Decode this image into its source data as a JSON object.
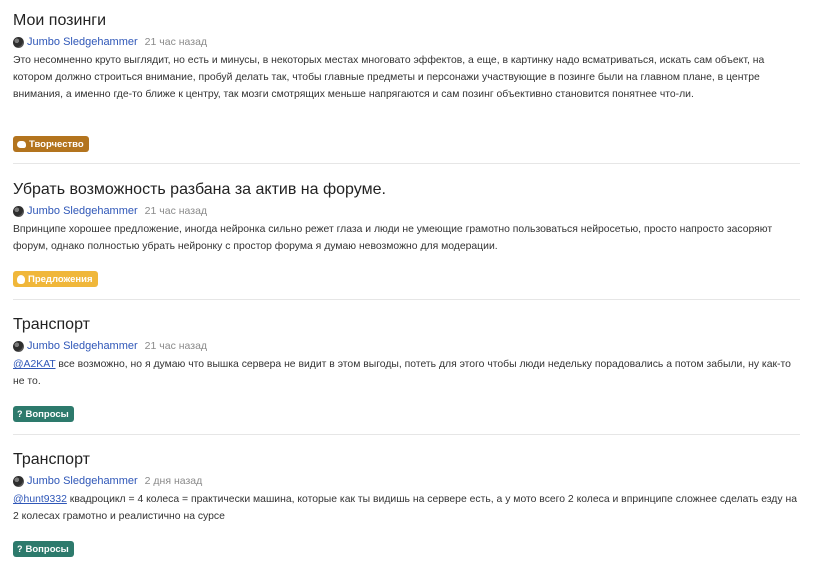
{
  "posts": [
    {
      "title": "Мои позинги",
      "author": "Jumbo Sledgehammer",
      "time": "21 час назад",
      "mention": "",
      "body": "Это несомненно круто выглядит, но есть и минусы, в некоторых местах многовато эффектов, а еще, в картинку надо всматриваться, искать сам объект, на котором должно строиться внимание, пробуй делать так, чтобы главные предметы и персонажи участвующие в позинге были на главном плане, в центре внимания, а именно где-то ближе к центру, так мозги смотрящих меньше напрягаются и сам позинг объективно становится понятнее что-ли.",
      "tag": "Творчество",
      "tag_icon": "palette-icon",
      "tag_color": "#b3741e"
    },
    {
      "title": "Убрать возможность разбана за актив на форуме.",
      "author": "Jumbo Sledgehammer",
      "time": "21 час назад",
      "mention": "",
      "body": "Впринципе хорошее предложение, иногда нейронка сильно режет глаза и люди не умеющие грамотно пользоваться нейросетью, просто напросто засоряют форум, однако полностью убрать нейронку с простор форума я думаю невозможно для модерации.",
      "tag": "Предложения",
      "tag_icon": "lightbulb-icon",
      "tag_color": "#f0b73a"
    },
    {
      "title": "Транспорт",
      "author": "Jumbo Sledgehammer",
      "time": "21 час назад",
      "mention": "@A2KAT",
      "body": " все возможно, но я думаю что вышка сервера не видит в этом выгоды, потеть для этого чтобы люди недельку порадовались а потом забыли, ну как-то не то.",
      "tag": "Вопросы",
      "tag_icon": "question-icon",
      "tag_color": "#2d7a6c"
    },
    {
      "title": "Транспорт",
      "author": "Jumbo Sledgehammer",
      "time": "2 дня назад",
      "mention": "@hunt9332",
      "body": " квадроцикл = 4 колеса = практически машина, которые как ты видишь на сервере есть, а у мото всего 2 колеса и впринципе сложнее сделать езду на 2 колесах грамотно и реалистично на сурсе",
      "tag": "Вопросы",
      "tag_icon": "question-icon",
      "tag_color": "#2d7a6c"
    }
  ],
  "icons": {
    "question_glyph": "?"
  }
}
